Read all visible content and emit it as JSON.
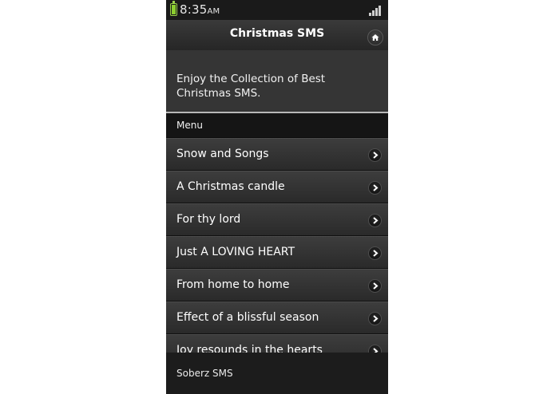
{
  "status_bar": {
    "time": "8:35",
    "ampm": "AM",
    "battery_color": "#8ccf2f"
  },
  "header": {
    "title": "Christmas SMS",
    "home_icon": "home-icon"
  },
  "intro": {
    "text": "Enjoy the Collection of Best Christmas SMS."
  },
  "menu": {
    "header": "Menu",
    "items": [
      {
        "label": "Snow and Songs"
      },
      {
        "label": "A Christmas candle"
      },
      {
        "label": "For thy lord"
      },
      {
        "label": "Just A LOVING HEART"
      },
      {
        "label": "From home to home"
      },
      {
        "label": "Effect of a blissful season"
      },
      {
        "label": "Joy resounds in the hearts"
      }
    ]
  },
  "footer": {
    "text": "Soberz SMS"
  }
}
